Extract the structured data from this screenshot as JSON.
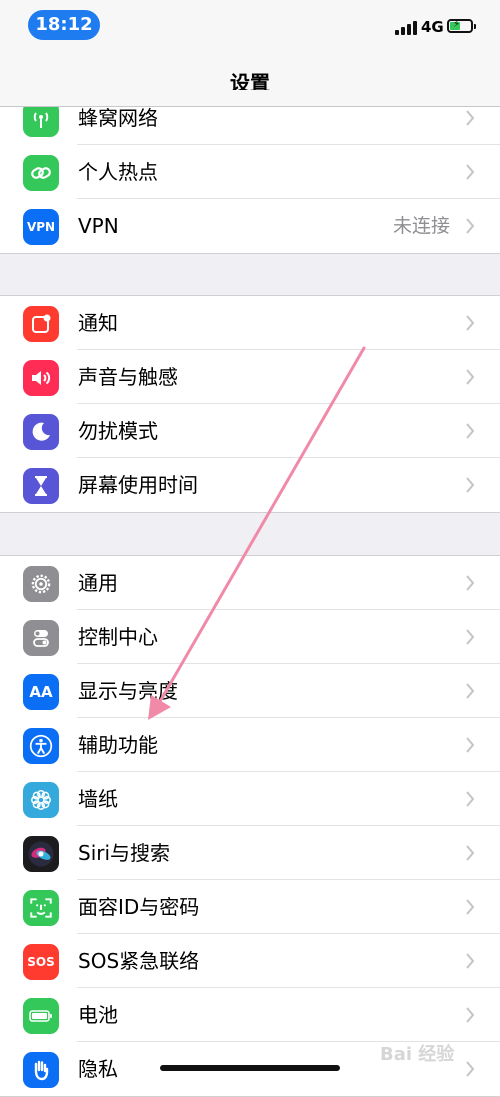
{
  "status": {
    "time": "18:12",
    "network": "4G"
  },
  "nav": {
    "title": "设置"
  },
  "groups": [
    {
      "rows": [
        {
          "label": "蜂窝网络",
          "icon": "cellular-antenna-icon",
          "color": "#34c759"
        },
        {
          "label": "个人热点",
          "icon": "hotspot-link-icon",
          "color": "#34c759"
        },
        {
          "label": "VPN",
          "icon": "vpn-icon",
          "icon_text": "VPN",
          "color": "#0a6ff5",
          "detail": "未连接"
        }
      ]
    },
    {
      "rows": [
        {
          "label": "通知",
          "icon": "notifications-icon",
          "color": "#ff3b30"
        },
        {
          "label": "声音与触感",
          "icon": "speaker-icon",
          "color": "#ff2d55"
        },
        {
          "label": "勿扰模式",
          "icon": "moon-icon",
          "color": "#5856d6"
        },
        {
          "label": "屏幕使用时间",
          "icon": "hourglass-icon",
          "color": "#5856d6"
        }
      ]
    },
    {
      "rows": [
        {
          "label": "通用",
          "icon": "gear-icon",
          "color": "#8e8e93"
        },
        {
          "label": "控制中心",
          "icon": "toggles-icon",
          "color": "#8e8e93"
        },
        {
          "label": "显示与亮度",
          "icon": "display-aa-icon",
          "icon_text": "AA",
          "color": "#0a6ff5"
        },
        {
          "label": "辅助功能",
          "icon": "accessibility-icon",
          "color": "#0a6ff5"
        },
        {
          "label": "墙纸",
          "icon": "wallpaper-flower-icon",
          "color": "#34aadc"
        },
        {
          "label": "Siri与搜索",
          "icon": "siri-icon",
          "color": "#1c1c1e"
        },
        {
          "label": "面容ID与密码",
          "icon": "face-id-icon",
          "color": "#34c759"
        },
        {
          "label": "SOS紧急联络",
          "icon": "sos-icon",
          "icon_text": "SOS",
          "color": "#ff3b30"
        },
        {
          "label": "电池",
          "icon": "battery-icon",
          "color": "#34c759"
        },
        {
          "label": "隐私",
          "icon": "privacy-hand-icon",
          "color": "#0a6ff5"
        }
      ]
    }
  ],
  "watermark": "Bai 经验"
}
